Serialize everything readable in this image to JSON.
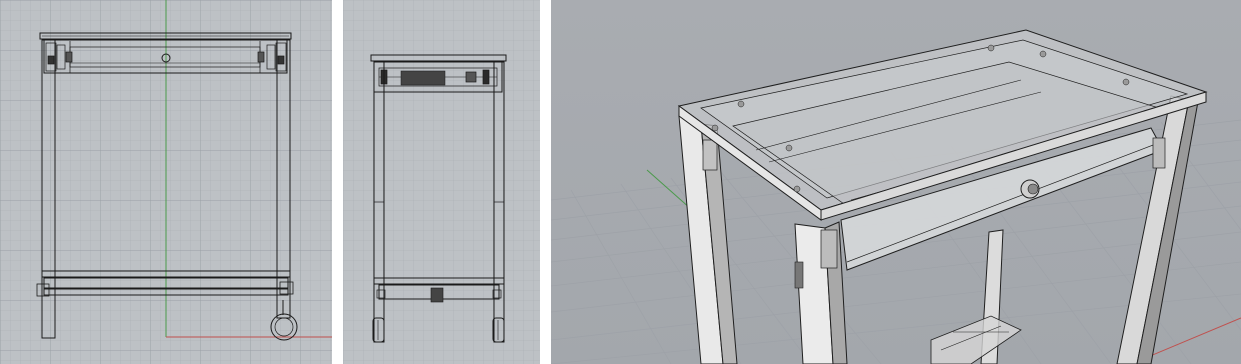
{
  "colors": {
    "background_gap": "#ffffff",
    "viewport_bg": "#bdc1c5",
    "persp_bg": "#a9acb1",
    "grid_minor": "#a9adb3",
    "grid_major": "#9aa0a6",
    "axis_x": "#c0504d",
    "axis_y": "#4b9a4b",
    "wire": "#1a1a1a"
  },
  "viewports": [
    {
      "id": "front",
      "projection": "orthographic-front"
    },
    {
      "id": "right",
      "projection": "orthographic-side"
    },
    {
      "id": "perspective",
      "projection": "perspective-shaded-ghosted"
    }
  ],
  "model": {
    "object": "side-table-with-drawer",
    "icons": [
      "drawer-knob-icon",
      "caster-wheel-icon"
    ]
  }
}
